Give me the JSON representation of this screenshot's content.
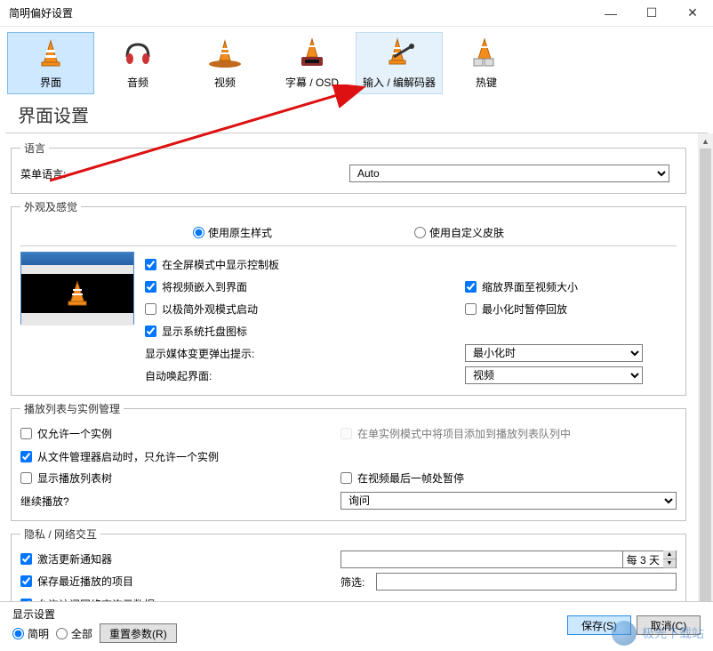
{
  "window": {
    "title": "简明偏好设置"
  },
  "toolbar": {
    "items": [
      {
        "label": "界面"
      },
      {
        "label": "音频"
      },
      {
        "label": "视频"
      },
      {
        "label": "字幕 / OSD"
      },
      {
        "label": "输入 / 编解码器"
      },
      {
        "label": "热键"
      }
    ]
  },
  "headline": "界面设置",
  "sections": {
    "language": {
      "legend": "语言",
      "menu_label": "菜单语言:",
      "menu_value": "Auto"
    },
    "appearance": {
      "legend": "外观及感觉",
      "radio_native": "使用原生样式",
      "radio_skin": "使用自定义皮肤",
      "cb_show_control": "在全屏模式中显示控制板",
      "cb_embed_video": "将视频嵌入到界面",
      "cb_scale_to_video": "缩放界面至视频大小",
      "cb_minimal_start": "以极简外观模式启动",
      "cb_minimize_on_pause": "最小化时暂停回放",
      "cb_systray": "显示系统托盘图标",
      "label_media_change": "显示媒体变更弹出提示:",
      "value_media_change": "最小化时",
      "label_auto_raise": "自动唤起界面:",
      "value_auto_raise": "视频"
    },
    "playlist": {
      "legend": "播放列表与实例管理",
      "cb_one_instance": "仅允许一个实例",
      "cb_enqueue_single": "在单实例模式中将项目添加到播放列表队列中",
      "cb_fm_one_instance": "从文件管理器启动时，只允许一个实例",
      "cb_show_tree": "显示播放列表树",
      "cb_pause_last_frame": "在视频最后一帧处暂停",
      "label_continue": "继续播放?",
      "value_continue": "询问"
    },
    "privacy": {
      "legend": "隐私 / 网络交互",
      "cb_activate_update": "激活更新通知器",
      "spin_text": "每 3 天",
      "cb_save_recent": "保存最近播放的项目",
      "label_filter": "筛选:",
      "cb_allow_net_meta": "允许访问网络查询元数据"
    }
  },
  "footer": {
    "label_display": "显示设置",
    "radio_simple": "简明",
    "radio_all": "全部",
    "btn_reset": "重置参数(R)",
    "btn_save": "保存(S)",
    "btn_cancel": "取消(C)"
  },
  "watermark_text": "极光下载站"
}
